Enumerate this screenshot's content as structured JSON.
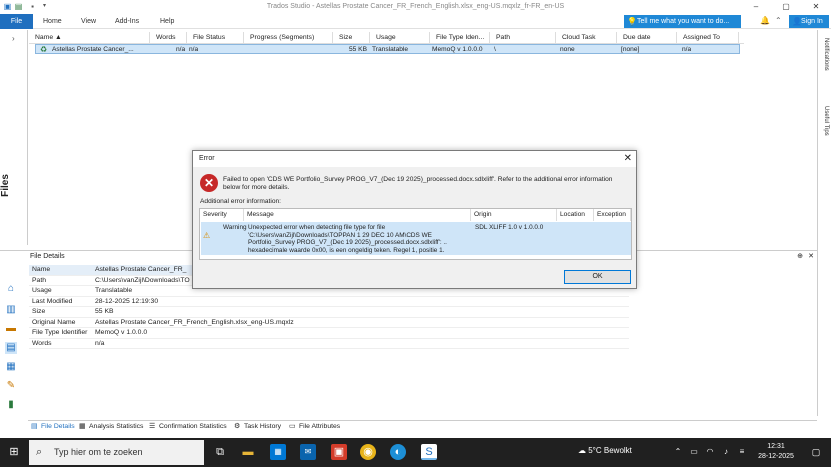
{
  "window": {
    "title": "Trados Studio - Astellas Prostate Cancer_FR_French_English.xlsx_eng-US.mqxlz_fr-FR_en-US"
  },
  "ribbon": {
    "file_label": "File",
    "tabs": [
      "Home",
      "View",
      "Add-Ins",
      "Help"
    ],
    "tell_me": "Tell me what you want to do...",
    "sign_in": "Sign In"
  },
  "left_panel": {
    "label": "Files"
  },
  "right_bar": {
    "notifications": "Notifications",
    "useful_tips": "Useful Tips"
  },
  "grid": {
    "columns": [
      "Name",
      "Words",
      "File Status",
      "Progress (Segments)",
      "Size",
      "Usage",
      "File Type Iden...",
      "Path",
      "Cloud Task",
      "Due date",
      "Assigned To"
    ],
    "row": {
      "name": "Astellas Prostate Cancer_...",
      "words": "n/a",
      "file_status": "n/a",
      "progress": "",
      "size": "55 KB",
      "usage": "Translatable",
      "file_type": "MemoQ v 1.0.0.0",
      "path": "\\",
      "cloud_task": "none",
      "due_date": "[none]",
      "assigned_to": "n/a"
    }
  },
  "file_details": {
    "title": "File Details",
    "rows": [
      {
        "k": "Name",
        "v": "Astellas Prostate Cancer_FR_"
      },
      {
        "k": "Path",
        "v": "C:\\Users\\vanZijl\\Downloads\\TO"
      },
      {
        "k": "Usage",
        "v": "Translatable"
      },
      {
        "k": "Last Modified",
        "v": "28-12-2025 12:19:30"
      },
      {
        "k": "Size",
        "v": "55 KB"
      },
      {
        "k": "Original Name",
        "v": "Astellas Prostate Cancer_FR_French_English.xlsx_eng-US.mqxlz"
      },
      {
        "k": "File Type Identifier",
        "v": "MemoQ v 1.0.0.0"
      },
      {
        "k": "Words",
        "v": "n/a"
      }
    ]
  },
  "bottom_tabs": [
    "File Details",
    "Analysis Statistics",
    "Confirmation Statistics",
    "Task History",
    "File Attributes"
  ],
  "dialog": {
    "title": "Error",
    "message": "Failed to open 'CDS WE Portfolio_Survey PROG_V7_(Dec 19 2025)_processed.docx.sdlxliff'. Refer to the additional error information below for more details.",
    "additional_label": "Additional error information:",
    "columns": [
      "Severity",
      "Message",
      "Origin",
      "Location",
      "Exception"
    ],
    "row": {
      "severity": "Warning",
      "message": "Unexpected error when detecting file type for file 'C:\\Users\\vanZijl\\Downloads\\TOPPAN 1 29 DEC 10 AM\\CDS WE Portfolio_Survey PROG_V7_(Dec 19 2025)_processed.docx.sdlxliff': .. hexadecimale waarde 0x00, is een ongeldig teken. Regel 1, positie 1.",
      "origin": "SDL XLIFF 1.0 v 1.0.0.0",
      "location": "",
      "exception": ""
    },
    "ok_label": "OK"
  },
  "taskbar": {
    "search_placeholder": "Typ hier om te zoeken",
    "weather": "5°C  Bewolkt",
    "time": "12:31",
    "date": "28-12-2025"
  },
  "colors": {
    "accent": "#1f6fbf",
    "selection": "#cfe5f8",
    "error": "#c62828",
    "taskbar": "#202020"
  }
}
